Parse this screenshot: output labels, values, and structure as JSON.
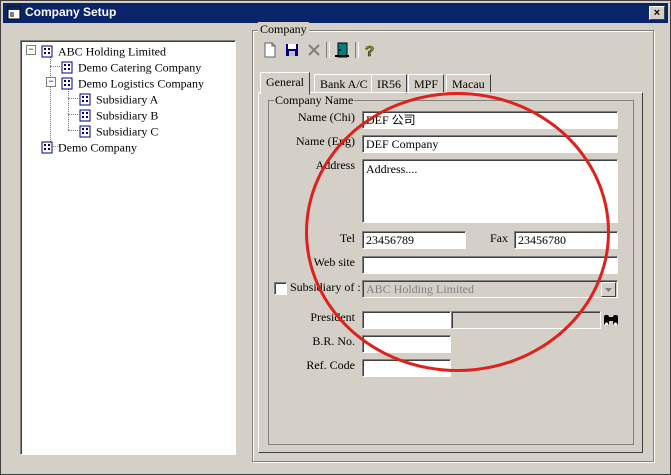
{
  "window": {
    "title": "Company Setup",
    "close_label": "×"
  },
  "tree": [
    {
      "label": "ABC Holding Limited",
      "expander": "−"
    },
    {
      "label": "Demo Catering Company"
    },
    {
      "label": "Demo Logistics Company",
      "expander": "−"
    },
    {
      "label": "Subsidiary A"
    },
    {
      "label": "Subsidiary B"
    },
    {
      "label": "Subsidiary C"
    },
    {
      "label": "Demo Company"
    }
  ],
  "company_group": {
    "label": "Company"
  },
  "toolbar": {
    "icons": [
      "new-document-icon",
      "save-icon",
      "delete-icon",
      "exit-door-icon",
      "help-icon"
    ]
  },
  "tabs": [
    {
      "label": "General",
      "active": true
    },
    {
      "label": "Bank A/C"
    },
    {
      "label": "IR56"
    },
    {
      "label": "MPF"
    },
    {
      "label": "Macau"
    }
  ],
  "form": {
    "group_label": "Company Name",
    "name_chi_label": "Name (Chi)",
    "name_chi_value": "DEF 公司",
    "name_eng_label": "Name (Eng)",
    "name_eng_value": "DEF Company",
    "address_label": "Address",
    "address_value": "Address....",
    "tel_label": "Tel",
    "tel_value": "23456789",
    "fax_label": "Fax",
    "fax_value": "23456780",
    "website_label": "Web site",
    "website_value": "",
    "subsidiary_label": "Subsidiary of :",
    "subsidiary_value": "ABC Holding Limited",
    "subsidiary_checked": false,
    "president_label": "President",
    "president_code": "",
    "president_name": "",
    "br_label": "B.R. No.",
    "br_value": "",
    "ref_label": "Ref. Code",
    "ref_value": ""
  },
  "colors": {
    "annotation": "#e0201b",
    "titlebar": "#0a246a",
    "face": "#d4d0c8"
  }
}
